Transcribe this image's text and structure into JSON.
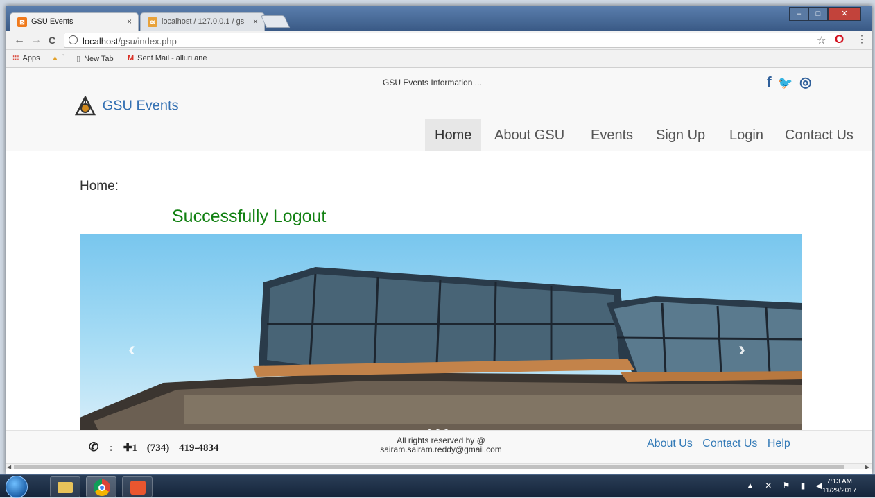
{
  "browser": {
    "tabs": [
      {
        "label": "GSU Events",
        "close": "×",
        "active": true
      },
      {
        "label": "localhost / 127.0.0.1 / gs",
        "close": "×",
        "active": false
      }
    ],
    "window_controls": {
      "minimize": "–",
      "maximize": "□",
      "close": "✕"
    },
    "nav": {
      "back": "←",
      "forward": "→",
      "reload": "C"
    },
    "address": {
      "host": "localhost",
      "path": "/gsu/index.php",
      "info_glyph": "i"
    },
    "star": "☆",
    "opera": "O",
    "menu": "⋮",
    "bookmarks": [
      {
        "label": "Apps",
        "icon": "apps-grid-icon",
        "glyph": "⁝⁝⁝"
      },
      {
        "label": "`",
        "icon": "xampp-icon",
        "glyph": "▲"
      },
      {
        "label": "New Tab",
        "icon": "page-icon",
        "glyph": "▯"
      },
      {
        "label": "Sent Mail - alluri.ane",
        "icon": "gmail-icon",
        "glyph": "M"
      }
    ]
  },
  "site": {
    "tagline": "GSU Events Information ...",
    "social": {
      "facebook": "f",
      "twitter": "🐦",
      "instagram": "◎"
    },
    "brand": "GSU Events",
    "menu": [
      {
        "label": "Home",
        "active": true
      },
      {
        "label": "About GSU",
        "active": false
      },
      {
        "label": "Events",
        "active": false
      },
      {
        "label": "Sign Up",
        "active": false
      },
      {
        "label": "Login",
        "active": false
      },
      {
        "label": "Contact Us",
        "active": false
      }
    ],
    "page_title": "Home:",
    "status_message": "Successfully Logout",
    "carousel": {
      "prev": "‹",
      "next": "›",
      "slides": 3,
      "active_slide": 1
    }
  },
  "footer": {
    "phone_icon": "✆",
    "colon": ":",
    "phone_plus": "✚1",
    "phone_area": "(734)",
    "phone_number": "419-4834",
    "copyright_line1": "All rights reserved by @",
    "copyright_line2": "sairam.sairam.reddy@gmail.com",
    "links": [
      "About Us",
      "Contact Us",
      "Help"
    ]
  },
  "taskbar": {
    "time": "7:13 AM",
    "date": "11/29/2017",
    "tray": "▲ ✕ ⚑ ▮ ◀"
  },
  "colors": {
    "brand_blue": "#3471b3",
    "success_green": "#118011",
    "link_blue": "#337ab7"
  }
}
